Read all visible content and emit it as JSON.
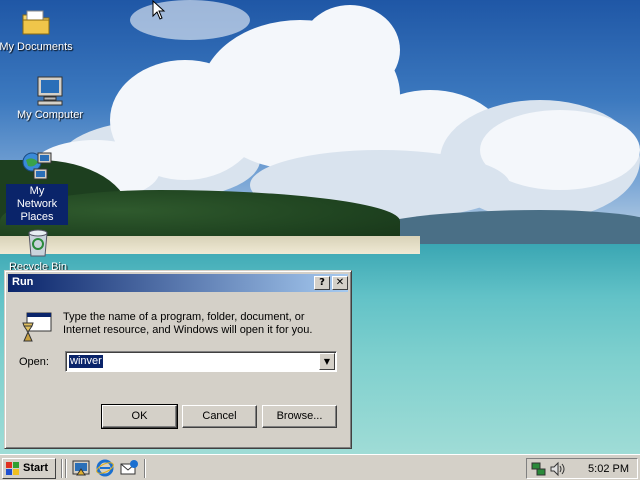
{
  "desktop": {
    "icons": [
      {
        "label": "My Documents",
        "icon": "my-documents-folder-icon"
      },
      {
        "label": "My Computer",
        "icon": "my-computer-icon"
      },
      {
        "label": "My Network Places",
        "icon": "network-places-icon"
      },
      {
        "label": "Recycle Bin",
        "icon": "recycle-bin-icon"
      }
    ]
  },
  "run_dialog": {
    "title": "Run",
    "help_button": "?",
    "close_button": "✕",
    "description": "Type the name of a program, folder, document, or Internet resource, and Windows will open it for you.",
    "open_label": "Open:",
    "open_value": "winver",
    "ok_label": "OK",
    "cancel_label": "Cancel",
    "browse_label": "Browse..."
  },
  "taskbar": {
    "start_label": "Start",
    "quick_launch": [
      "show-desktop-icon",
      "internet-explorer-icon",
      "outlook-express-icon"
    ],
    "tray_icons": [
      "network-tray-icon",
      "volume-icon"
    ],
    "clock": "5:02 PM"
  },
  "colors": {
    "title_bar_start": "#0a246a",
    "title_bar_end": "#a6caf0",
    "face": "#d4d0c8",
    "selection": "#0a246a"
  }
}
